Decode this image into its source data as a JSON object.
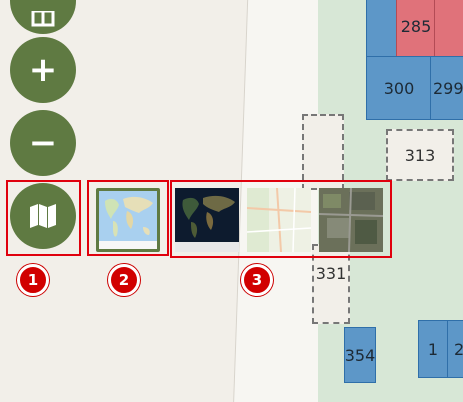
{
  "map": {
    "lots": [
      "285",
      "300",
      "299",
      "313",
      "331",
      "354",
      "1",
      "2"
    ]
  },
  "controls": {
    "zoom_in_label": "+",
    "zoom_out_label": "−"
  },
  "badges": [
    "1",
    "2",
    "3"
  ],
  "basemaps": [
    {
      "name": "street-map",
      "selected": true
    },
    {
      "name": "dark-satellite"
    },
    {
      "name": "light-street"
    },
    {
      "name": "satellite-imagery"
    }
  ],
  "colors": {
    "control_green": "#5f7a42",
    "highlight_red": "#e0000d",
    "lot_blue": "#5d97c8"
  }
}
